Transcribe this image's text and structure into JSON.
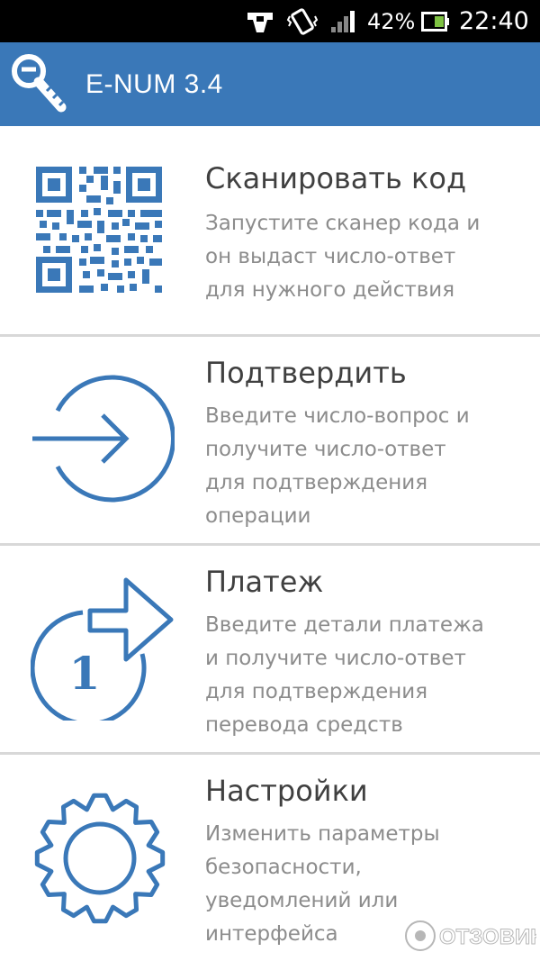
{
  "status_bar": {
    "battery_percent": "42%",
    "time": "22:40",
    "icons": [
      "notification-icon",
      "vibrate-icon",
      "signal-icon",
      "battery-icon"
    ]
  },
  "app_bar": {
    "title": "E-NUM 3.4",
    "logo_icon": "enum-key-logo",
    "background_color": "#3a78b8"
  },
  "menu": {
    "items": [
      {
        "title": "Сканировать код",
        "description": "Запустите сканер кода и\nон выдаст число-ответ\nдля нужного действия",
        "icon": "qr-code-icon"
      },
      {
        "title": "Подтвердить",
        "description": "Введите число-вопрос и\nполучите число-ответ\nдля подтверждения\nоперации",
        "icon": "enter-arrow-icon"
      },
      {
        "title": "Платеж",
        "description": "Введите детали платежа\nи получите число-ответ\nдля подтверждения\nперевода средств",
        "icon": "payment-icon"
      },
      {
        "title": "Настройки",
        "description": "Изменить параметры\nбезопасности,\nуведомлений или\nинтерфейса",
        "icon": "gear-icon"
      }
    ]
  },
  "watermark": {
    "text": "ОТЗОВИК"
  },
  "colors": {
    "accent": "#3a78b8",
    "title_text": "#404040",
    "description_text": "#8c8c8c",
    "divider": "#d8d8d8"
  }
}
